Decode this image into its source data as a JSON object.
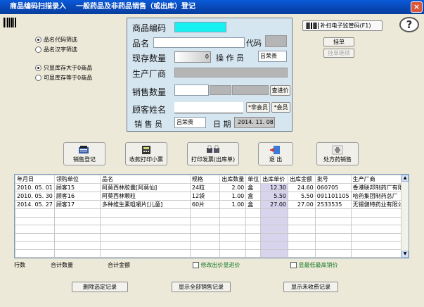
{
  "window": {
    "title": "商品编码扫描录入",
    "subtitle": "一般药品及非药品销售（或出库）登记",
    "close_label": "×"
  },
  "filters": {
    "code_filter": "品名代码筛选",
    "name_filter": "品名汉字筛选",
    "stock_gt_zero": "只显库存大于0商品",
    "stock_ge_zero": "可显库存等于0商品"
  },
  "form": {
    "product_code_label": "商品编码",
    "product_name_label": "品名",
    "code_label": "代码",
    "stock_label": "现存数量",
    "stock_value": "0",
    "operator_label": "操 作 员",
    "operator_value": "吕荣贵",
    "manufacturer_label": "生产厂商",
    "sale_qty_label": "销售数量",
    "check_price_button": "查进价",
    "customer_label": "顾客姓名",
    "non_member_button": "*非会员",
    "member_button": "*会员",
    "salesperson_label": "销 售 员",
    "salesperson_value": "吕荣贵",
    "date_label": "日 期",
    "date_value": "2014. 11. 08"
  },
  "right_panel": {
    "scan_button": "补扫电子监管码(F1)",
    "hang_button": "挂单",
    "resume_button": "挂单继续",
    "help_label": "?"
  },
  "actions": {
    "sale_register": "销售登记",
    "print_receipt": "收款打印小票",
    "print_invoice": "打印发票(出库单)",
    "exit": "退  出",
    "prescription": "处方药销售"
  },
  "table": {
    "headers": [
      "年月日",
      "领购单位",
      "品名",
      "规格",
      "出库数量",
      "单位",
      "出库单价",
      "出库金额",
      "批号",
      "生产厂商"
    ],
    "rows": [
      [
        "2010. 05. 01",
        "顾客15",
        "阿莫西林胶囊[阿莫仙]",
        "24粒",
        "2.00",
        "盒",
        "12.30",
        "24.60",
        "060705",
        "香港联邦制药厂有限"
      ],
      [
        "2010. 05. 30",
        "顾客16",
        "阿莫西林颗粒",
        "12袋",
        "1.00",
        "盒",
        "5.50",
        "5.50",
        "091101105",
        "哈药集团制药总厂"
      ],
      [
        "2014. 05. 27",
        "顾客17",
        "多种维生素咀嚼片[儿童]",
        "60片",
        "1.00",
        "盒",
        "27.00",
        "27.00",
        "2533535",
        "无锡健特药业有限公"
      ]
    ],
    "empty_row_count": 7
  },
  "footer": {
    "row_count_label": "行数",
    "total_qty_label": "合计数量",
    "total_amount_label": "合计金额",
    "edit_price_label": "修改出价显进价",
    "show_high_low_label": "显最低最高销价"
  },
  "bottom_buttons": {
    "delete": "删除选定记录",
    "show_all": "显示全部销售记录",
    "show_unpaid": "显示未收费记录"
  }
}
